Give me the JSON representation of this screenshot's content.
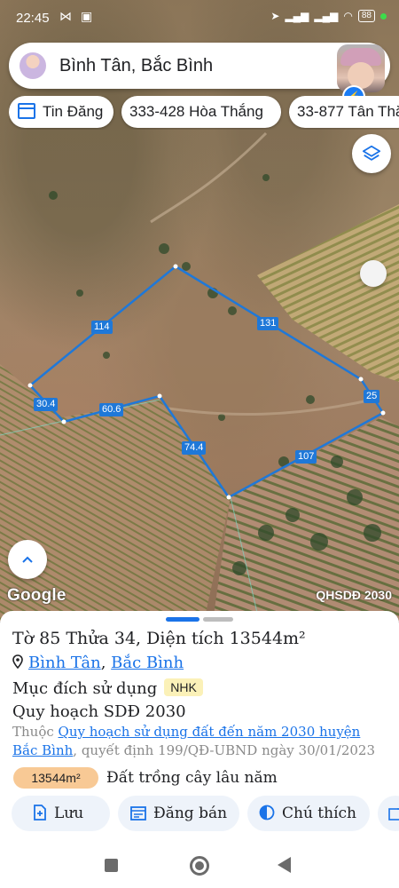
{
  "status_bar": {
    "time": "22:45",
    "battery": "88"
  },
  "search": {
    "query": "Bình Tân, Bắc Bình"
  },
  "chips": [
    {
      "label": "Tin Đăng"
    },
    {
      "label": "333-428 Hòa Thắng"
    },
    {
      "label": "33-877 Tân Thắ"
    }
  ],
  "map": {
    "edge_labels": [
      "114",
      "131",
      "25",
      "107",
      "74.4",
      "60.6",
      "30.4"
    ],
    "google_logo": "Google",
    "layer_label": "QHSDĐ 2030"
  },
  "sheet": {
    "title": "Tờ 85 Thửa 34, Diện tích 13544m²",
    "location_1": "Bình Tân",
    "location_sep": ", ",
    "location_2": "Bắc Bình",
    "purpose_label": "Mục đích sử dụng",
    "purpose_code": "NHK",
    "plan_label": "Quy hoạch SDĐ 2030",
    "desc_prefix": "Thuộc ",
    "desc_link": "Quy hoạch sử dụng đất đến năm 2030 huyện Bắc Bình",
    "desc_suffix": ", quyết định 199/QĐ-UBND ngày 30/01/2023",
    "area_badge": "13544m²",
    "area_text": "Đất trồng cây lâu năm"
  },
  "actions": [
    {
      "label": "Lưu"
    },
    {
      "label": "Đăng bán"
    },
    {
      "label": "Chú thích"
    }
  ],
  "colors": {
    "accent": "#1a73e8",
    "parcel_line": "#1f78d8",
    "area_badge": "#f8c995",
    "nhk_badge": "#fbf1b8"
  }
}
